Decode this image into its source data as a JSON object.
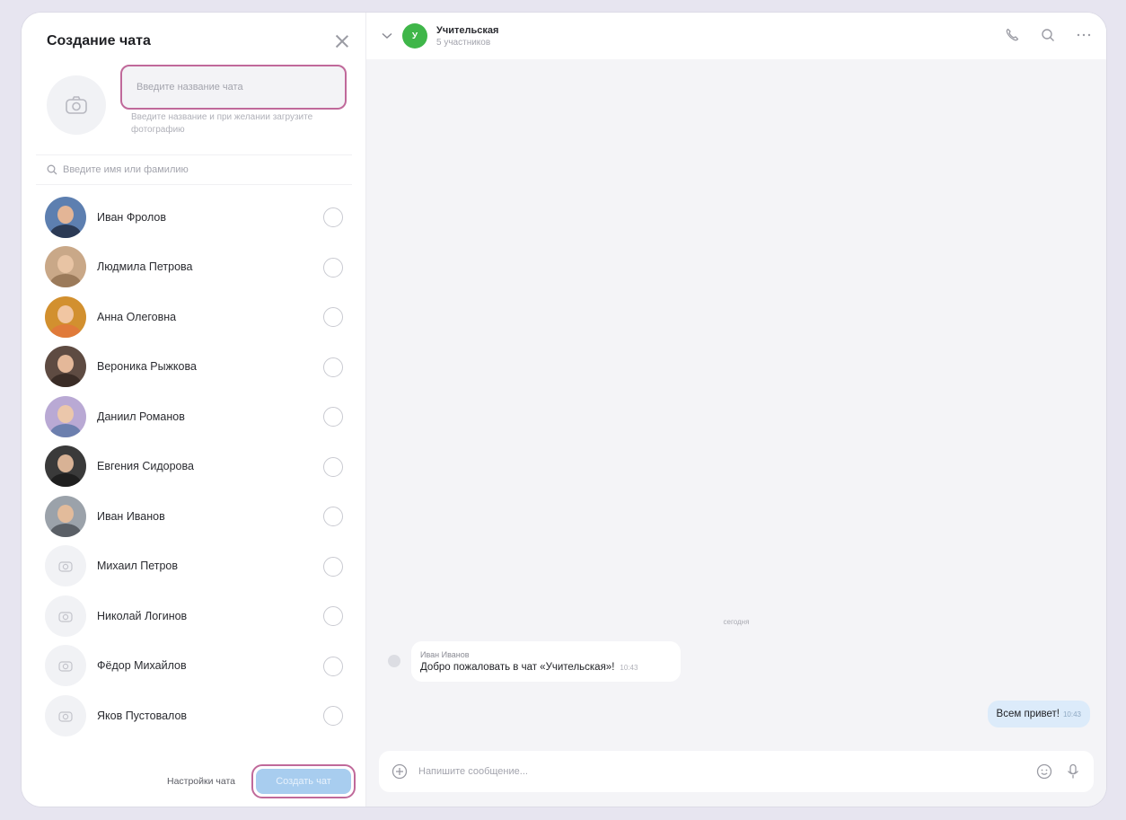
{
  "left_panel": {
    "title": "Создание чата",
    "name_input": {
      "placeholder": "Введите название чата",
      "value": ""
    },
    "name_hint": "Введите название и при желании загрузите фотографию",
    "search": {
      "placeholder": "Введите имя или фамилию"
    },
    "contacts": [
      {
        "name": "Иван Фролов",
        "avatar": "photo",
        "head": "#e3b596",
        "body": "#2b3a55",
        "bg": "#5d7fb0"
      },
      {
        "name": "Людмила Петрова",
        "avatar": "photo",
        "head": "#e8c4a4",
        "body": "#9b7a5a",
        "bg": "#c9a888"
      },
      {
        "name": "Анна Олеговна",
        "avatar": "photo",
        "head": "#f1c6a2",
        "body": "#e07a3a",
        "bg": "#d2902f"
      },
      {
        "name": "Вероника Рыжкова",
        "avatar": "photo",
        "head": "#e4b899",
        "body": "#3a2c26",
        "bg": "#5e4b42"
      },
      {
        "name": "Даниил Романов",
        "avatar": "photo",
        "head": "#ebc7ab",
        "body": "#6c7fae",
        "bg": "#b9a9d4"
      },
      {
        "name": "Евгения Сидорова",
        "avatar": "photo",
        "head": "#d8b295",
        "body": "#1f1f1f",
        "bg": "#3a3a3a"
      },
      {
        "name": "Иван Иванов",
        "avatar": "photo",
        "head": "#e2bb9b",
        "body": "#5a5f66",
        "bg": "#9ba2aa"
      },
      {
        "name": "Михаил Петров",
        "avatar": "camera"
      },
      {
        "name": "Николай Логинов",
        "avatar": "camera"
      },
      {
        "name": "Фёдор Михайлов",
        "avatar": "camera"
      },
      {
        "name": "Яков Пустовалов",
        "avatar": "camera"
      }
    ],
    "footer": {
      "settings_label": "Настройки чата",
      "create_label": "Создать чат"
    }
  },
  "chat": {
    "avatar_letter": "У",
    "title": "Учительская",
    "subtitle": "5 участников",
    "date_separator": "сегодня",
    "incoming": {
      "author": "Иван Иванов",
      "text": "Добро пожаловать в чат «Учительская»!",
      "time": "10:43"
    },
    "outgoing": {
      "text": "Всем привет!",
      "time": "10:43"
    },
    "composer": {
      "placeholder": "Напишите сообщение..."
    }
  },
  "colors": {
    "highlight_border": "#c0699a",
    "chat_avatar": "#3fb649",
    "create_button": "#a8cdef",
    "outgoing_bubble": "#dcebfa"
  },
  "icons": [
    "close-icon",
    "camera-icon",
    "search-icon",
    "chevron-down-icon",
    "phone-icon",
    "more-icon",
    "attach-icon",
    "emoji-icon",
    "microphone-icon"
  ]
}
